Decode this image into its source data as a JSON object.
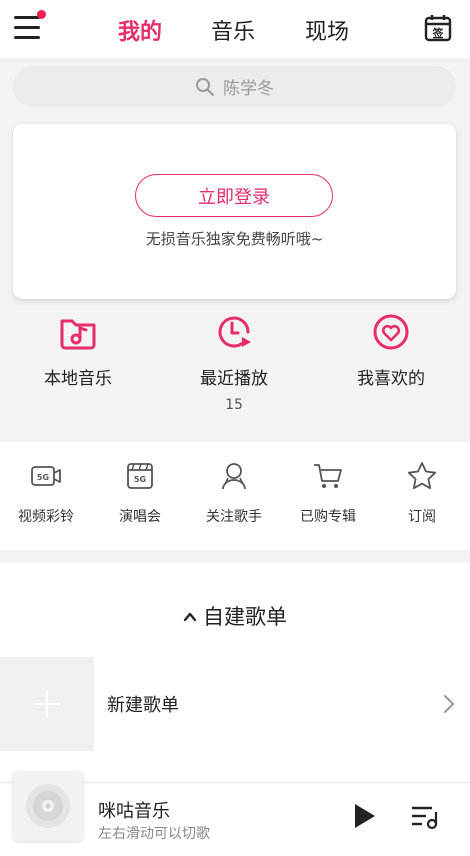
{
  "header": {
    "tabs": [
      {
        "label": "我的",
        "active": true
      },
      {
        "label": "音乐",
        "active": false
      },
      {
        "label": "现场",
        "active": false
      }
    ],
    "calendar_icon_text": "签",
    "menu_icon": "hamburger-menu-icon",
    "badge_color": "#e8214e"
  },
  "search": {
    "placeholder": "陈学冬"
  },
  "login": {
    "button_label": "立即登录",
    "tip": "无损音乐独家免费畅听哦~"
  },
  "quick_access": [
    {
      "label": "本地音乐",
      "icon": "music-folder-icon"
    },
    {
      "label": "最近播放",
      "count": "15",
      "icon": "recent-play-icon"
    },
    {
      "label": "我喜欢的",
      "icon": "heart-icon"
    }
  ],
  "shortcuts": [
    {
      "label": "视频彩铃",
      "icon": "5g-video-icon"
    },
    {
      "label": "演唱会",
      "icon": "5g-concert-icon"
    },
    {
      "label": "关注歌手",
      "icon": "singer-icon"
    },
    {
      "label": "已购专辑",
      "icon": "cart-icon"
    },
    {
      "label": "订阅",
      "icon": "star-icon"
    }
  ],
  "playlists": {
    "header": "自建歌单",
    "new_label": "新建歌单"
  },
  "player": {
    "title": "咪咕音乐",
    "subtitle": "左右滑动可以切歌"
  },
  "colors": {
    "accent": "#e72c6a",
    "background": "#f3f3f3"
  }
}
